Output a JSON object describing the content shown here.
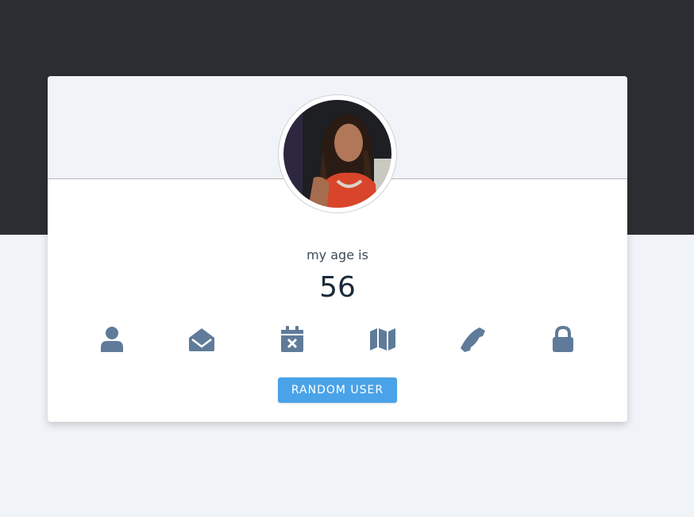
{
  "profile": {
    "label": "my age is",
    "value": "56"
  },
  "icons": [
    {
      "name": "user-icon"
    },
    {
      "name": "envelope-open-icon"
    },
    {
      "name": "calendar-times-icon"
    },
    {
      "name": "map-icon"
    },
    {
      "name": "phone-icon"
    },
    {
      "name": "lock-icon"
    }
  ],
  "button": {
    "label": "RANDOM USER"
  },
  "colors": {
    "top_band": "#2c2e33",
    "page_bg": "#f0f4f8",
    "icon": "#5f7b99",
    "button": "#4aa3e8"
  }
}
